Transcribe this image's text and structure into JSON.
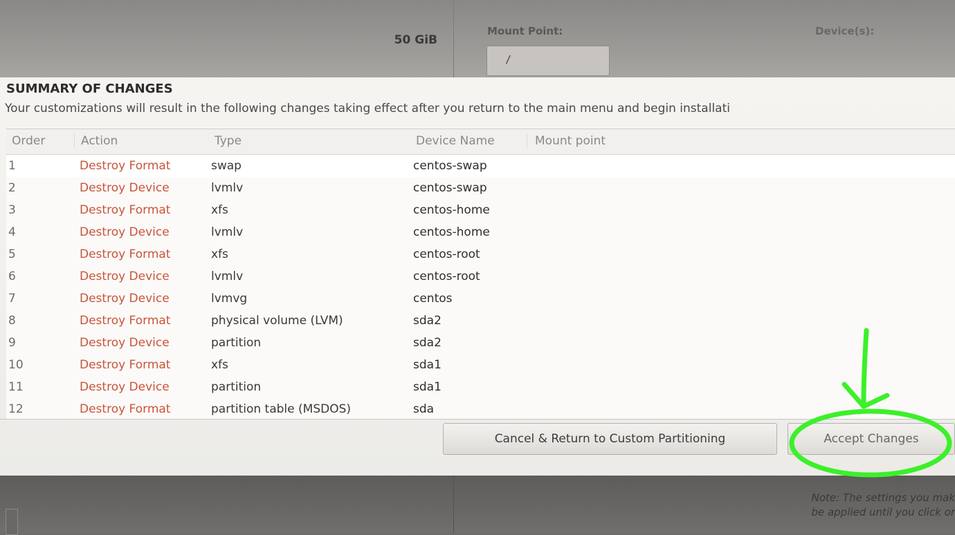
{
  "backdrop": {
    "size": "50 GiB",
    "mount_point_label": "Mount Point:",
    "mount_point_value": "/",
    "devices_label": "Device(s):"
  },
  "dialog": {
    "title": "SUMMARY OF CHANGES",
    "description": "Your customizations will result in the following changes taking effect after you return to the main menu and begin installati",
    "columns": {
      "order": "Order",
      "action": "Action",
      "type": "Type",
      "device_name": "Device Name",
      "mount_point": "Mount point"
    },
    "rows": [
      {
        "order": "1",
        "action": "Destroy Format",
        "type": "swap",
        "device": "centos-swap"
      },
      {
        "order": "2",
        "action": "Destroy Device",
        "type": "lvmlv",
        "device": "centos-swap"
      },
      {
        "order": "3",
        "action": "Destroy Format",
        "type": "xfs",
        "device": "centos-home"
      },
      {
        "order": "4",
        "action": "Destroy Device",
        "type": "lvmlv",
        "device": "centos-home"
      },
      {
        "order": "5",
        "action": "Destroy Format",
        "type": "xfs",
        "device": "centos-root"
      },
      {
        "order": "6",
        "action": "Destroy Device",
        "type": "lvmlv",
        "device": "centos-root"
      },
      {
        "order": "7",
        "action": "Destroy Device",
        "type": "lvmvg",
        "device": "centos"
      },
      {
        "order": "8",
        "action": "Destroy Format",
        "type": "physical volume (LVM)",
        "device": "sda2"
      },
      {
        "order": "9",
        "action": "Destroy Device",
        "type": "partition",
        "device": "sda2"
      },
      {
        "order": "10",
        "action": "Destroy Format",
        "type": "xfs",
        "device": "sda1"
      },
      {
        "order": "11",
        "action": "Destroy Device",
        "type": "partition",
        "device": "sda1"
      },
      {
        "order": "12",
        "action": "Destroy Format",
        "type": "partition table (MSDOS)",
        "device": "sda"
      }
    ],
    "cancel_label": "Cancel & Return to Custom Partitioning",
    "accept_label": "Accept Changes"
  },
  "note": {
    "line1": "Note:  The settings you mak",
    "line2": "be applied until you click or"
  },
  "colors": {
    "action_text": "#c9543a",
    "annotation": "#3cf02a"
  }
}
